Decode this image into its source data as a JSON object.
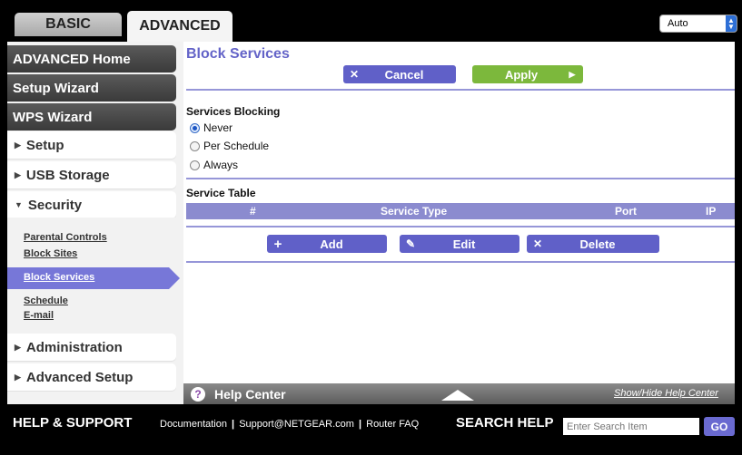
{
  "tabs": {
    "basic": "BASIC",
    "advanced": "ADVANCED"
  },
  "language": {
    "selected": "Auto"
  },
  "sidebar": {
    "advanced_home": "ADVANCED Home",
    "setup_wizard": "Setup Wizard",
    "wps_wizard": "WPS Wizard",
    "setup": "Setup",
    "usb_storage": "USB Storage",
    "security": "Security",
    "security_items": [
      "Parental Controls",
      "Block Sites",
      "Block Services",
      "Schedule",
      "E-mail"
    ],
    "administration": "Administration",
    "advanced_setup": "Advanced Setup"
  },
  "page": {
    "title": "Block Services",
    "cancel": "Cancel",
    "apply": "Apply",
    "services_blocking_label": "Services Blocking",
    "options": [
      "Never",
      "Per Schedule",
      "Always"
    ],
    "selected_option": "Never",
    "service_table_label": "Service Table",
    "columns": [
      "#",
      "Service Type",
      "Port",
      "IP"
    ],
    "add": "Add",
    "edit": "Edit",
    "delete": "Delete"
  },
  "help_center": {
    "title": "Help Center",
    "toggle": "Show/Hide Help Center"
  },
  "footer": {
    "help_support": "HELP & SUPPORT",
    "links": [
      "Documentation",
      "Support@NETGEAR.com",
      "Router FAQ"
    ],
    "search_help": "SEARCH HELP",
    "search_placeholder": "Enter Search Item",
    "go": "GO"
  },
  "colors": {
    "accent": "#6464c8",
    "apply": "#7cb83c",
    "dark_nav": "#444444"
  }
}
